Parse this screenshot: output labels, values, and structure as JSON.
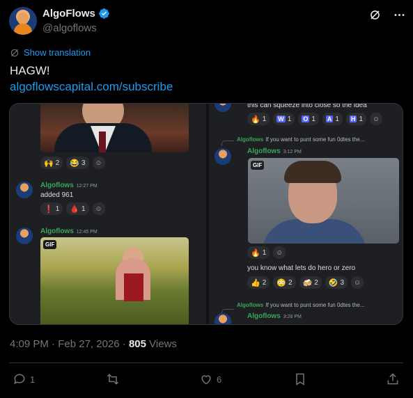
{
  "author": {
    "name": "AlgoFlows",
    "handle": "@algoflows",
    "verified": true
  },
  "header_icons": [
    "grok-icon",
    "more-icon"
  ],
  "translate": {
    "label": "Show translation"
  },
  "tweet": {
    "text": "HAGW!",
    "link": "algoflowscapital.com/subscribe"
  },
  "media": {
    "left": {
      "top_reactions": [
        {
          "emoji": "🙌",
          "count": "2"
        },
        {
          "emoji": "😂",
          "count": "3"
        }
      ],
      "msg1": {
        "name": "Algoflows",
        "time": "12:27 PM",
        "text": "added 961"
      },
      "msg1_reactions": [
        {
          "emoji": "❗",
          "count": "1"
        },
        {
          "emoji": "🩸",
          "count": "1"
        }
      ],
      "msg2": {
        "name": "Algoflows",
        "time": "12:45 PM"
      },
      "gif_label": "GIF"
    },
    "right": {
      "top_text": "this can squeeze into close so the idea",
      "top_reactions": [
        {
          "emoji": "🔥",
          "count": "1"
        },
        {
          "emoji": "W",
          "count": "1"
        },
        {
          "emoji": "O",
          "count": "1"
        },
        {
          "emoji": "A",
          "count": "1"
        },
        {
          "emoji": "H",
          "count": "1"
        }
      ],
      "reply1": {
        "name": "Algoflows",
        "text": "If you want to punt some fun 0dtes the..."
      },
      "msg1": {
        "name": "Algoflows",
        "time": "3:12 PM"
      },
      "gif_label": "GIF",
      "msg1_reactions": [
        {
          "emoji": "🔥",
          "count": "1"
        }
      ],
      "msg2_text": "you know what lets do hero or zero",
      "msg2_reactions": [
        {
          "emoji": "👍",
          "count": "2"
        },
        {
          "emoji": "😳",
          "count": "2"
        },
        {
          "emoji": "🍻",
          "count": "2"
        },
        {
          "emoji": "🤣",
          "count": "3"
        }
      ],
      "reply2": {
        "name": "Algoflows",
        "text": "If you want to punt some fun 0dtes the..."
      },
      "msg3": {
        "name": "Algoflows",
        "time": "3:28 PM"
      }
    }
  },
  "meta": {
    "time": "4:09 PM",
    "date": "Feb 27, 2026",
    "views_count": "805",
    "views_label": "Views"
  },
  "actions": {
    "replies": "1",
    "reposts": "",
    "likes": "6"
  },
  "colors": {
    "accent": "#1d9bf0",
    "discord_name": "#3ba55c",
    "background": "#000000"
  }
}
